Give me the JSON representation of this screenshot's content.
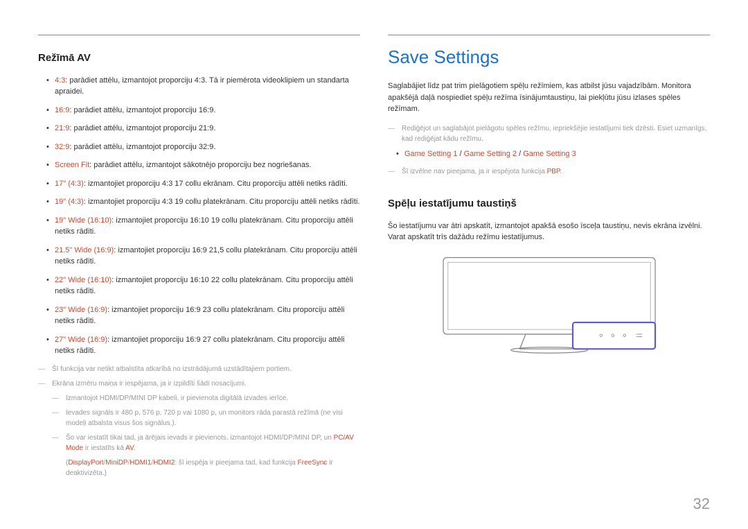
{
  "left": {
    "heading": "Režīmā AV",
    "items": [
      {
        "kw": "4:3",
        "txt": ": parādiet attēlu, izmantojot proporciju 4:3. Tā ir piemērota videoklipiem un standarta apraidei."
      },
      {
        "kw": "16:9",
        "txt": ": parādiet attēlu, izmantojot proporciju 16:9."
      },
      {
        "kw": "21:9",
        "txt": ": parādiet attēlu, izmantojot proporciju 21:9."
      },
      {
        "kw": "32:9",
        "txt": ": parādiet attēlu, izmantojot proporciju 32:9."
      },
      {
        "kw": "Screen Fit",
        "txt": ": parādiet attēlu, izmantojot sākotnējo proporciju bez nogriešanas."
      },
      {
        "kw": "17\" (4:3)",
        "txt": ": izmantojiet proporciju 4:3 17 collu ekrānam. Citu proporciju attēli netiks rādīti."
      },
      {
        "kw": "19\" (4:3)",
        "txt": ": izmantojiet proporciju 4:3 19 collu platekrānam. Citu proporciju attēli netiks rādīti."
      },
      {
        "kw": "19\" Wide (16:10)",
        "txt": ": izmantojiet proporciju 16:10 19 collu platekrānam. Citu proporciju attēli netiks rādīti."
      },
      {
        "kw": "21.5\" Wide (16:9)",
        "txt": ": izmantojiet proporciju 16:9 21,5 collu platekrānam. Citu proporciju attēli netiks rādīti."
      },
      {
        "kw": "22\" Wide (16:10)",
        "txt": ": izmantojiet proporciju 16:10 22 collu platekrānam. Citu proporciju attēli netiks rādīti."
      },
      {
        "kw": "23\" Wide (16:9)",
        "txt": ": izmantojiet proporciju 16:9 23 collu platekrānam. Citu proporciju attēli netiks rādīti."
      },
      {
        "kw": "27\" Wide (16:9)",
        "txt": ": izmantojiet proporciju 16:9 27 collu platekrānam. Citu proporciju attēli netiks rādīti."
      }
    ],
    "note1": "Šī funkcija var netikt atbalstīta atkarībā no izstrādājumā uzstādītajiem portiem.",
    "note2": "Ekrāna izmēru maiņa ir iespējama, ja ir izpildīti šādi nosacījumi.",
    "sub1": "Izmantojot HDMI/DP/MINI DP kabeli, ir pievienota digitālā izvades ierīce.",
    "sub2": "Ievades signāls ir 480 p, 576 p, 720 p vai 1080 p, un monitors rāda parastā režīmā (ne visi modeļi atbalsta visus šos signālus.).",
    "sub3_a": "Šo var iestatīt tikai tad, ja ārējais ievads ir pievienots, izmantojot HDMI/DP/MINI DP, un ",
    "sub3_kw1": "PC/AV Mode",
    "sub3_b": " ir iestatīts kā ",
    "sub3_kw2": "AV",
    "sub3_c": ".",
    "sub4_a": "(",
    "sub4_kw1": "DisplayPort",
    "sub4_sep": "/",
    "sub4_kw2": "MiniDP",
    "sub4_kw3": "HDMI1",
    "sub4_kw4": "HDMI2",
    "sub4_b": ": šī iespēja ir pieejama tad, kad funkcija ",
    "sub4_kw5": "FreeSync",
    "sub4_c": " ir deaktivizēta.)"
  },
  "right": {
    "main_heading": "Save Settings",
    "intro": "Saglabājiet līdz pat trim pielāgotiem spēļu režīmiem, kas atbilst jūsu vajadzībām. Monitora apakšējā daļā nospiediet spēļu režīma īsinājumtaustiņu, lai piekļūtu jūsu izlases spēles režīmam.",
    "note1": "Rediģējot un saglabājot pielāgotu spēles režīmu, iepriekšējie iestatījumi tiek dzēsti. Esiet uzmanīgs, kad rediģējat kādu režīmu.",
    "bullet_kw1": "Game Setting 1",
    "bullet_sep": " / ",
    "bullet_kw2": "Game Setting 2",
    "bullet_kw3": "Game Setting 3",
    "note2_a": "Šī izvēlne nav pieejama, ja ir iespējota funkcija ",
    "note2_kw": "PBP",
    "note2_b": ".",
    "sub_heading": "Spēļu iestatījumu taustiņš",
    "sub_intro": "Šo iestatījumu var ātri apskatīt, izmantojot apakšā esošo īsceļa taustiņu, nevis ekrāna izvēlni. Varat apskatīt trīs dažādu režīmu iestatījumus."
  },
  "page_number": "32"
}
